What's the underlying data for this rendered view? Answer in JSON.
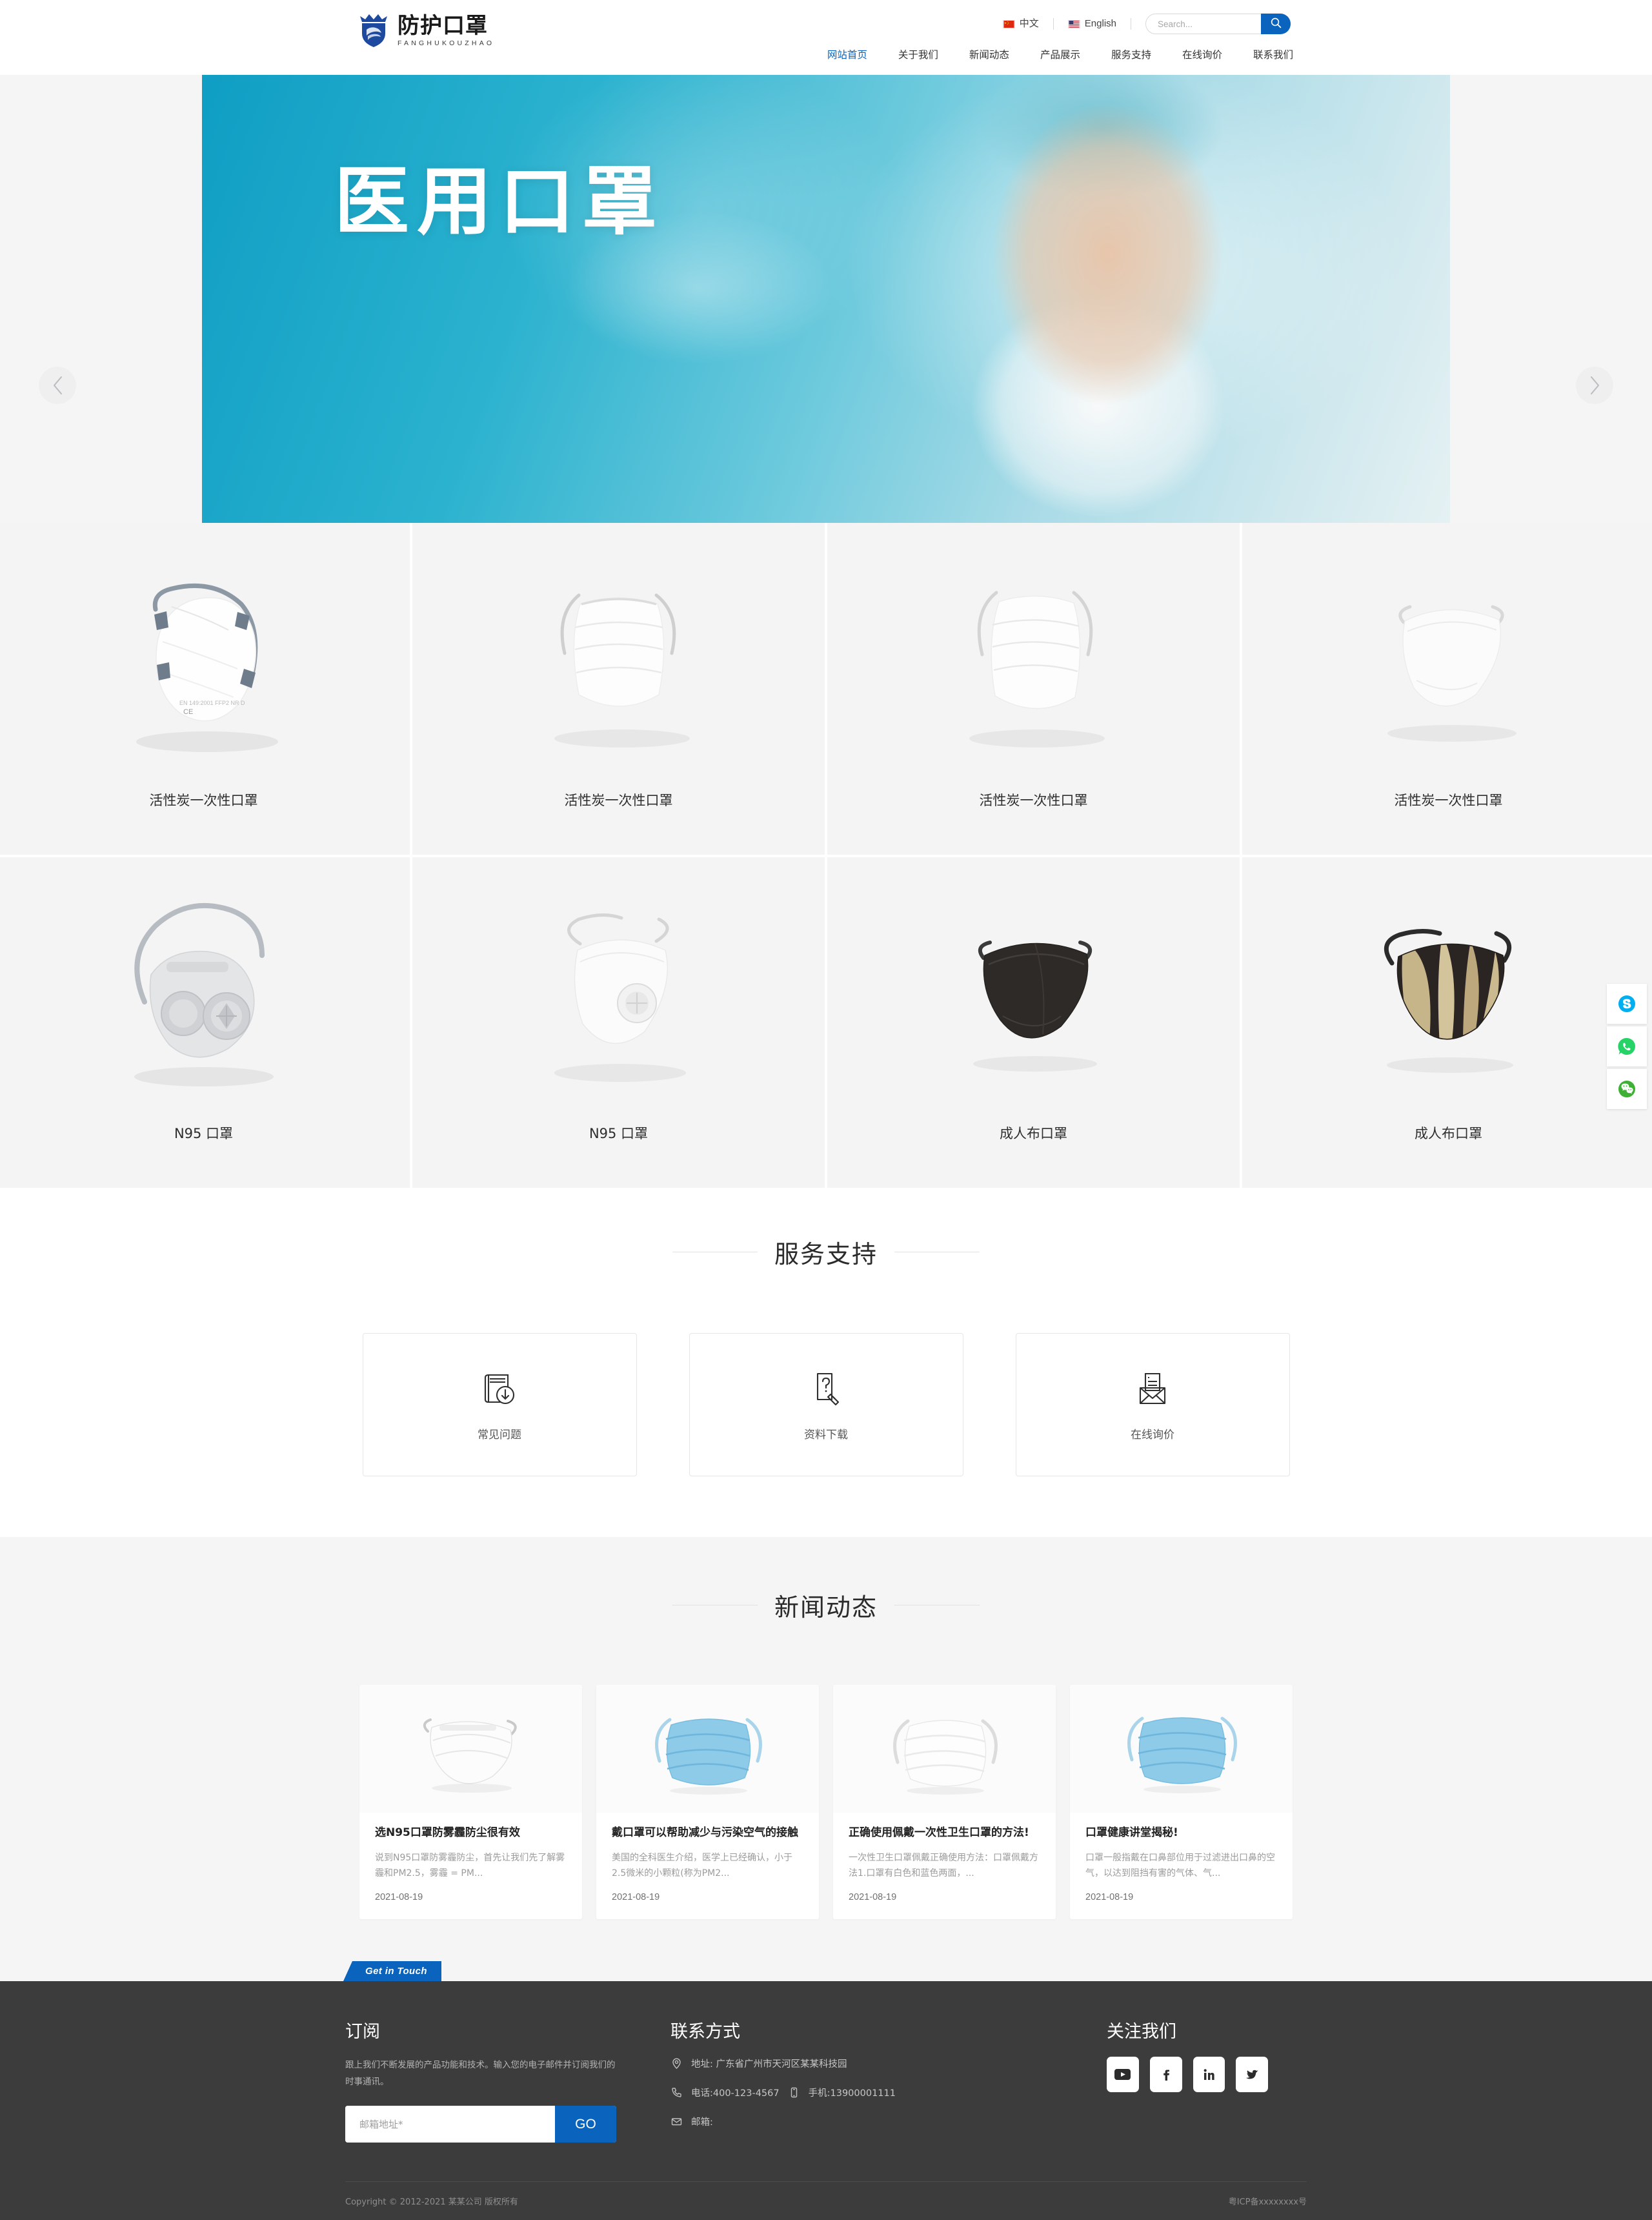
{
  "brand": {
    "logo_icon": "crown-shield-icon",
    "name_cn": "防护口罩",
    "name_en": "FANGHUKOUZHAO",
    "accent_color": "#0a63bd",
    "logo_color": "#1d4a9e"
  },
  "header": {
    "languages": [
      {
        "label": "中文",
        "icon": "flag-cn-icon",
        "active": true
      },
      {
        "label": "English",
        "icon": "flag-us-icon",
        "active": false
      }
    ],
    "search": {
      "placeholder": "Search...",
      "value": "",
      "button_icon": "search-icon"
    },
    "nav": [
      {
        "label": "网站首页",
        "active": true
      },
      {
        "label": "关于我们",
        "active": false
      },
      {
        "label": "新闻动态",
        "active": false
      },
      {
        "label": "产品展示",
        "active": false
      },
      {
        "label": "服务支持",
        "active": false
      },
      {
        "label": "在线询价",
        "active": false
      },
      {
        "label": "联系我们",
        "active": false
      }
    ]
  },
  "hero": {
    "title": "医用口罩",
    "prev_icon": "chevron-left-icon",
    "next_icon": "chevron-right-icon",
    "dots": [
      {
        "active": true
      },
      {
        "active": false
      }
    ]
  },
  "products": [
    {
      "label": "活性炭一次性口罩",
      "image": "cup-respirator-mask"
    },
    {
      "label": "活性炭一次性口罩",
      "image": "surgical-mask-white"
    },
    {
      "label": "活性炭一次性口罩",
      "image": "surgical-mask-white-2"
    },
    {
      "label": "活性炭一次性口罩",
      "image": "cloth-mask-white"
    },
    {
      "label": "N95 口罩",
      "image": "reusable-respirator-gray"
    },
    {
      "label": "N95 口罩",
      "image": "valve-mask-white"
    },
    {
      "label": "成人布口罩",
      "image": "cloth-mask-black"
    },
    {
      "label": "成人布口罩",
      "image": "cloth-mask-camo"
    }
  ],
  "service": {
    "title": "服务支持",
    "cards": [
      {
        "label": "常见问题",
        "icon": "book-download-icon"
      },
      {
        "label": "资料下载",
        "icon": "question-document-icon"
      },
      {
        "label": "在线询价",
        "icon": "envelope-icon"
      }
    ]
  },
  "news": {
    "title": "新闻动态",
    "items": [
      {
        "title": "选N95口罩防雾霾防尘很有效",
        "desc": "说到N95口罩防雾霾防尘，首先让我们先了解雾霾和PM2.5，雾霾 = PM...",
        "date": "2021-08-19",
        "thumb": "n95-mask-photo"
      },
      {
        "title": "戴口罩可以帮助减少与污染空气的接触",
        "desc": "美国的全科医生介绍，医学上已经确认，小于2.5微米的小颗粒(称为PM2...",
        "date": "2021-08-19",
        "thumb": "blue-surgical-mask-photo"
      },
      {
        "title": "正确使用佩戴一次性卫生口罩的方法!",
        "desc": "一次性卫生口罩佩戴正确使用方法：口罩佩戴方法1.口罩有白色和蓝色两面，...",
        "date": "2021-08-19",
        "thumb": "white-surgical-mask-photo"
      },
      {
        "title": "口罩健康讲堂揭秘!",
        "desc": "口罩一般指戴在口鼻部位用于过滤进出口鼻的空气，以达到阻挡有害的气体、气...",
        "date": "2021-08-19",
        "thumb": "blue-mask-photo"
      }
    ]
  },
  "footer": {
    "get_in_touch": "Get in Touch",
    "subscribe": {
      "title": "订阅",
      "desc": "跟上我们不断发展的产品功能和技术。输入您的电子邮件并订阅我们的时事通讯。",
      "placeholder": "邮箱地址*",
      "value": "",
      "button": "GO"
    },
    "contact": {
      "title": "联系方式",
      "address_icon": "location-pin-icon",
      "address": "地址: 广东省广州市天河区某某科技园",
      "phone_icon": "phone-icon",
      "phone": "电话:400-123-4567",
      "mobile_icon": "mobile-icon",
      "mobile": "手机:13900001111",
      "email_icon": "mail-icon",
      "email": "邮箱:"
    },
    "follow": {
      "title": "关注我们",
      "socials": [
        {
          "name": "youtube-icon",
          "label": "YouTube"
        },
        {
          "name": "facebook-icon",
          "label": "Facebook"
        },
        {
          "name": "linkedin-icon",
          "label": "LinkedIn"
        },
        {
          "name": "twitter-icon",
          "label": "Twitter"
        }
      ]
    },
    "copyright_left": "Copyright © 2012-2021 某某公司 版权所有",
    "copyright_right": "粤ICP备xxxxxxxx号"
  },
  "float_bar": [
    {
      "name": "skype-icon",
      "label": "Skype",
      "color": "#00AFF0"
    },
    {
      "name": "whatsapp-icon",
      "label": "WhatsApp",
      "color": "#25D366"
    },
    {
      "name": "wechat-icon",
      "label": "WeChat",
      "color": "#3EB134"
    }
  ]
}
